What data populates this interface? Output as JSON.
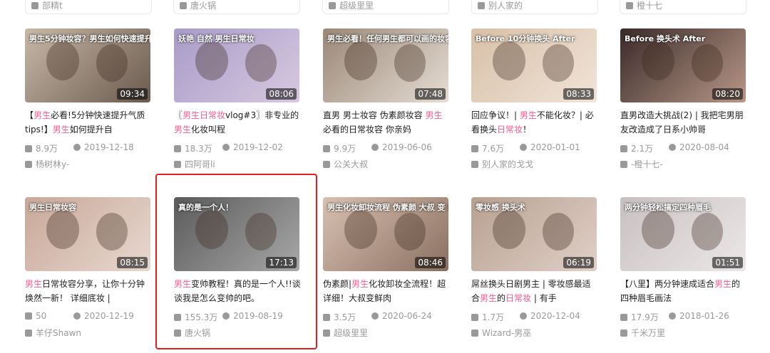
{
  "top_row": [
    "部精t",
    "唐火锅",
    "超级里里",
    "别人家的",
    "橙十七"
  ],
  "videos": [
    {
      "title_parts": [
        [
          "【",
          0
        ],
        [
          "男生",
          1
        ],
        [
          "必看!5分钟快速提升气质tips!】",
          0
        ],
        [
          "男生",
          1
        ],
        [
          "如何提升自",
          0
        ]
      ],
      "duration": "09:34",
      "views": "8.9万",
      "date": "2019-12-18",
      "uploader": "杨树林y-",
      "overlay": "男生5分钟妆容？男生如何快速提升自我气场？",
      "colors": [
        "#c8b8a8",
        "#6a5a4e"
      ]
    },
    {
      "title_parts": [
        [
          "〖",
          0
        ],
        [
          "男生日常妆",
          1
        ],
        [
          "vlog#3〗非专业的",
          0
        ],
        [
          "男生",
          1
        ],
        [
          "化妆叫程",
          0
        ]
      ],
      "duration": "08:06",
      "views": "18.3万",
      "date": "2019-12-02",
      "uploader": "四阿哥li",
      "overlay": "妖艳 自然 男生日常妆",
      "colors": [
        "#a89cc8",
        "#d8c8e0"
      ]
    },
    {
      "title_parts": [
        [
          "直男 男士妆容 伪素颜妆容 ",
          0
        ],
        [
          "男生",
          1
        ],
        [
          "必看的日常妆容 你亲妈",
          0
        ]
      ],
      "duration": "07:48",
      "views": "9.9万",
      "date": "2019-06-06",
      "uploader": "公关大叔",
      "overlay": "男生必看！任何男生都可以画的妆容",
      "colors": [
        "#9a8878",
        "#e6ddd4"
      ]
    },
    {
      "title_parts": [
        [
          "回应争议！| ",
          0
        ],
        [
          "男生",
          1
        ],
        [
          "不能化妆？| 必看换头",
          0
        ],
        [
          "日常妆",
          1
        ],
        [
          "！",
          0
        ]
      ],
      "duration": "08:33",
      "views": "7.6万",
      "date": "2020-01-01",
      "uploader": "别人家的戈戈",
      "overlay": "Before 10分钟换头 After",
      "colors": [
        "#d8c0a8",
        "#f0e4d8"
      ]
    },
    {
      "title_parts": [
        [
          "直男改造大挑战(2) | 我把宅男朋友改造成了日系小帅哥",
          0
        ]
      ],
      "duration": "08:20",
      "views": "2.1万",
      "date": "2020-08-04",
      "uploader": "-橙十七-",
      "overlay": "Before 换头术 After",
      "colors": [
        "#3a2a2a",
        "#b89888"
      ]
    },
    {
      "title_parts": [
        [
          "男生",
          1
        ],
        [
          "日常妆容分享，让你十分钟焕然一新！ 详细底妆 |",
          0
        ]
      ],
      "duration": "08:15",
      "views": "50",
      "date": "2020-12-19",
      "uploader": "羊仔Shawn",
      "overlay": "男生日常妆容",
      "colors": [
        "#c8a898",
        "#e8d8d0"
      ]
    },
    {
      "title_parts": [
        [
          "男生",
          1
        ],
        [
          "变帅教程！真的是一个人!!谈谈我是怎么变帅的吧。",
          0
        ]
      ],
      "duration": "17:13",
      "views": "155.3万",
      "date": "2019-08-19",
      "uploader": "唐火锅",
      "overlay": "真的是一个人！",
      "colors": [
        "#5a5a5a",
        "#a8a8a8"
      ]
    },
    {
      "title_parts": [
        [
          "伪素颜|",
          0
        ],
        [
          "男生",
          1
        ],
        [
          "化妆卸妆全流程！超详细！大叔变鲜肉",
          0
        ]
      ],
      "duration": "08:46",
      "views": "3.5万",
      "date": "2020-06-24",
      "uploader": "超级里里",
      "overlay": "男生化妆卸妆流程 伪素颜 大叔 变 鲜肉",
      "colors": [
        "#d8c0b0",
        "#8a7060"
      ]
    },
    {
      "title_parts": [
        [
          "屌丝换头日剧男主 | 零妆感最适合",
          0
        ],
        [
          "男生",
          1
        ],
        [
          "的",
          0
        ],
        [
          "日常妆",
          1
        ],
        [
          " | 有手",
          0
        ]
      ],
      "duration": "06:19",
      "views": "1.7万",
      "date": "2020-12-04",
      "uploader": "Wizard-男巫",
      "overlay": "零妆感 换头术",
      "colors": [
        "#b8a090",
        "#e0d0c8"
      ]
    },
    {
      "title_parts": [
        [
          "【八里】两分钟速成适合",
          0
        ],
        [
          "男生",
          1
        ],
        [
          "的四种眉毛画法",
          0
        ]
      ],
      "duration": "01:51",
      "views": "17.9万",
      "date": "2018-01-26",
      "uploader": "千米万里",
      "overlay": "两分钟轻松搞定四种眉毛",
      "colors": [
        "#c8c0c0",
        "#ece8e8"
      ]
    }
  ]
}
